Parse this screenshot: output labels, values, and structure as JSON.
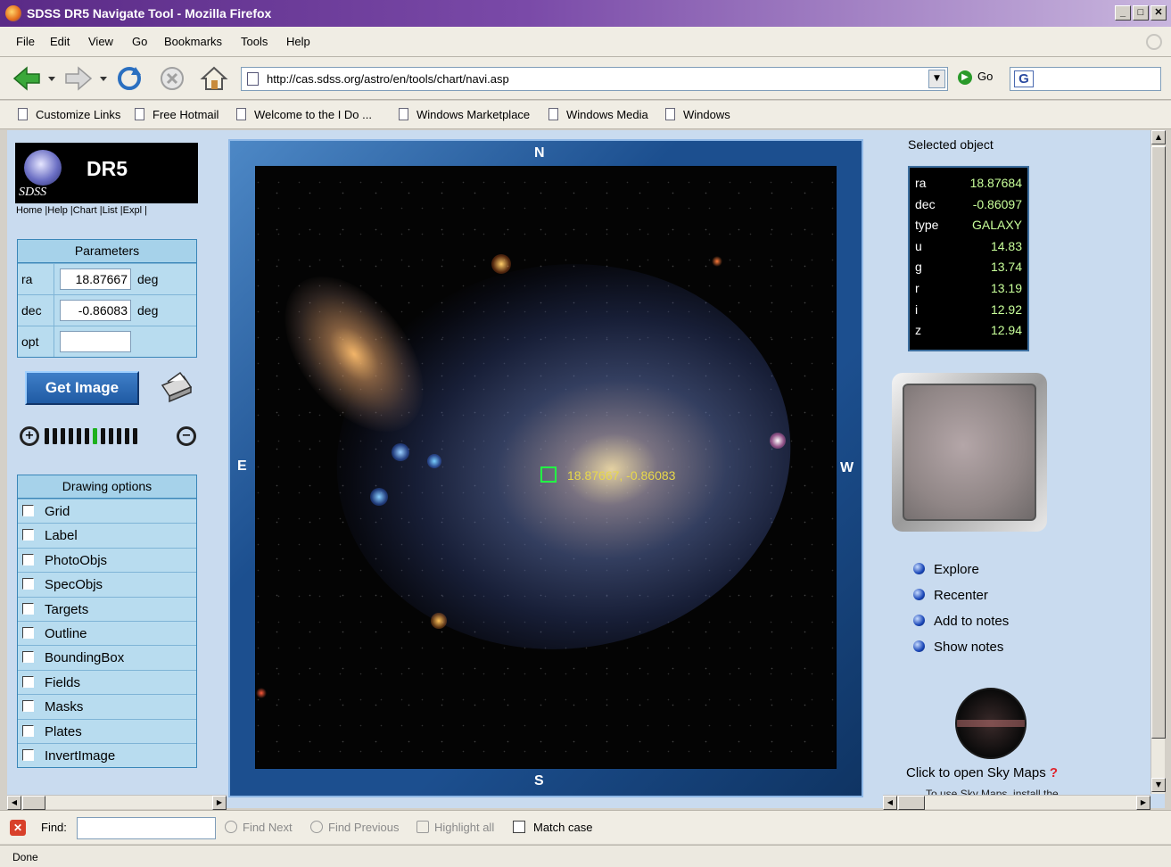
{
  "window": {
    "title": "SDSS DR5 Navigate Tool - Mozilla Firefox",
    "controls": [
      "_",
      "□",
      "✕"
    ]
  },
  "menu": [
    "File",
    "Edit",
    "View",
    "Go",
    "Bookmarks",
    "Tools",
    "Help"
  ],
  "navbar": {
    "url": "http://cas.sdss.org/astro/en/tools/chart/navi.asp",
    "go_label": "Go",
    "search_icon": "G"
  },
  "bookmarks": [
    "Customize Links",
    "Free Hotmail",
    "Welcome to the I Do ...",
    "Windows Marketplace",
    "Windows Media",
    "Windows"
  ],
  "left": {
    "logo_text": "DR5",
    "logo_sub": "SDSS",
    "top_links": "Home |Help |Chart |List |Expl |",
    "parameters": {
      "heading": "Parameters",
      "rows": [
        {
          "label": "ra",
          "value": "18.87667",
          "unit": "deg"
        },
        {
          "label": "dec",
          "value": "-0.86083",
          "unit": "deg"
        },
        {
          "label": "opt",
          "value": "",
          "unit": ""
        }
      ]
    },
    "get_image_label": "Get Image",
    "zoom": {
      "steps": 12,
      "active_step": 6
    },
    "drawing_options": {
      "heading": "Drawing options",
      "items": [
        "Grid",
        "Label",
        "PhotoObjs",
        "SpecObjs",
        "Targets",
        "Outline",
        "BoundingBox",
        "Fields",
        "Masks",
        "Plates",
        "InvertImage"
      ]
    }
  },
  "map": {
    "north": "N",
    "south": "S",
    "east": "E",
    "west": "W",
    "coord_label": "18.87667, -0.86083"
  },
  "right": {
    "selected_heading": "Selected object",
    "object": [
      {
        "key": "ra",
        "value": "18.87684"
      },
      {
        "key": "dec",
        "value": "-0.86097"
      },
      {
        "key": "type",
        "value": "GALAXY"
      },
      {
        "key": "u",
        "value": "14.83"
      },
      {
        "key": "g",
        "value": "13.74"
      },
      {
        "key": "r",
        "value": "13.19"
      },
      {
        "key": "i",
        "value": "12.92"
      },
      {
        "key": "z",
        "value": "12.94"
      }
    ],
    "actions": [
      "Explore",
      "Recenter",
      "Add to notes",
      "Show notes"
    ],
    "skymaps_label": "Click to open Sky Maps",
    "skymaps_q": "?",
    "skymaps_tip": "To use Sky Maps, install the"
  },
  "findbar": {
    "label": "Find:",
    "value": "",
    "find_next": "Find Next",
    "find_previous": "Find Previous",
    "highlight_all": "Highlight all",
    "match_case": "Match case"
  },
  "status": "Done",
  "colors": {
    "content_bg": "#c9dbef",
    "frame_blue": "#1c4f8f",
    "panel_bg": "#b8dcef",
    "coord_label": "#e8d84a",
    "marker": "#22ff44"
  }
}
